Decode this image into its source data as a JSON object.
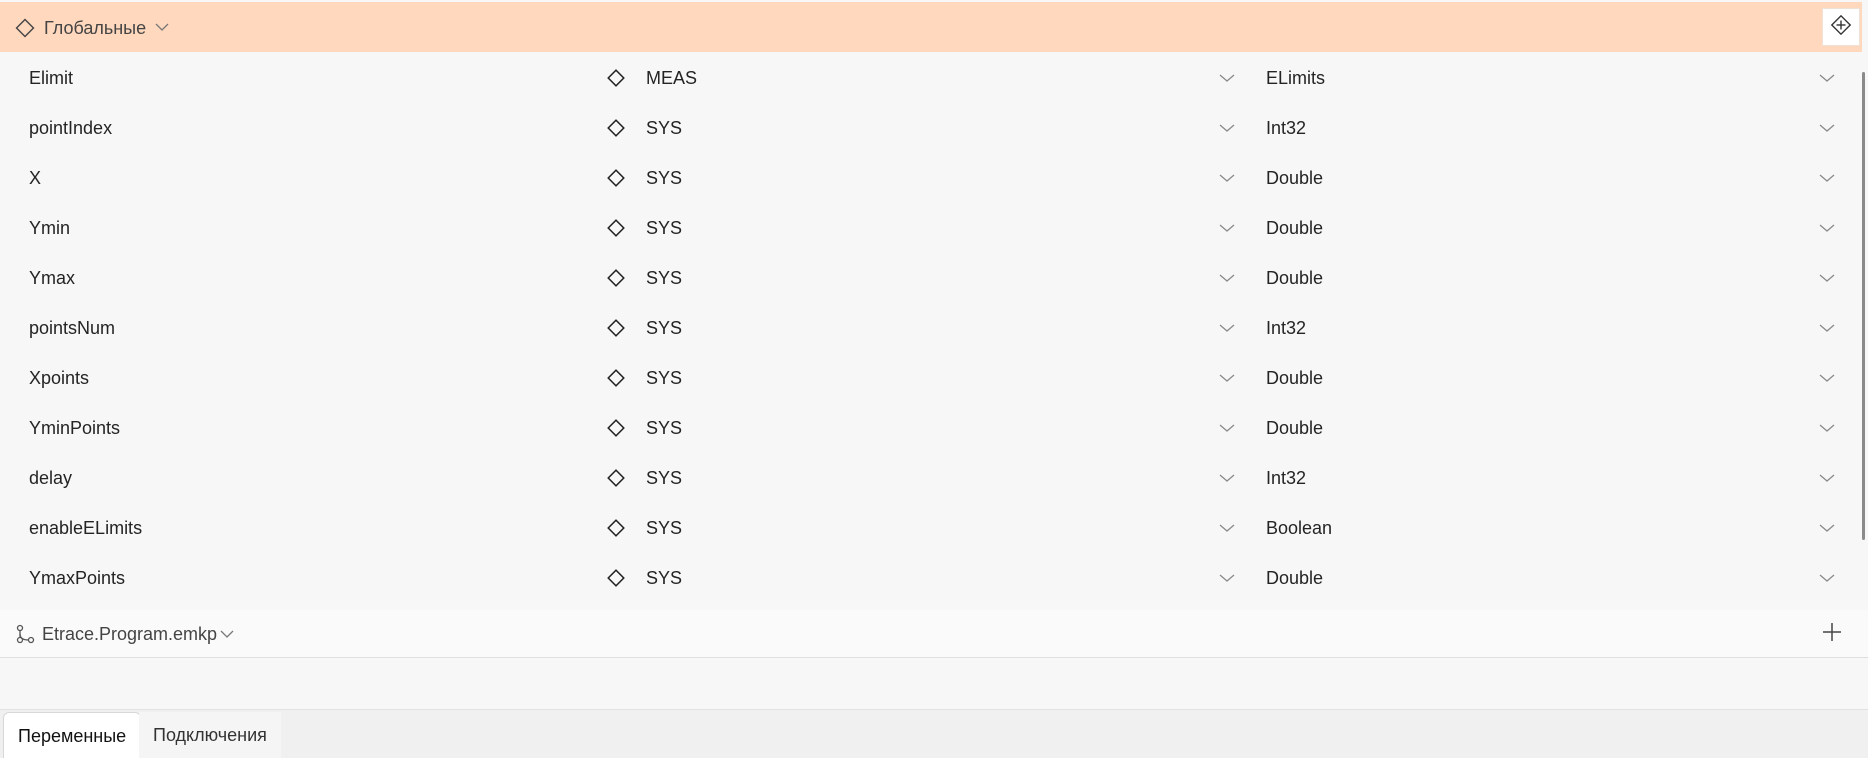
{
  "globals_header": {
    "label": "Глобальные",
    "icon": "diamond-icon",
    "chevron": "chevron-down-icon",
    "add_button_icon": "diamond-plus-icon",
    "background": "#ffd8bd"
  },
  "variables": [
    {
      "name": "Elimit",
      "scope": "MEAS",
      "type": "ELimits"
    },
    {
      "name": "pointIndex",
      "scope": "SYS",
      "type": "Int32"
    },
    {
      "name": "X",
      "scope": "SYS",
      "type": "Double"
    },
    {
      "name": "Ymin",
      "scope": "SYS",
      "type": "Double"
    },
    {
      "name": "Ymax",
      "scope": "SYS",
      "type": "Double"
    },
    {
      "name": "pointsNum",
      "scope": "SYS",
      "type": "Int32"
    },
    {
      "name": "Xpoints",
      "scope": "SYS",
      "type": "Double"
    },
    {
      "name": "YminPoints",
      "scope": "SYS",
      "type": "Double"
    },
    {
      "name": "delay",
      "scope": "SYS",
      "type": "Int32"
    },
    {
      "name": "enableELimits",
      "scope": "SYS",
      "type": "Boolean"
    },
    {
      "name": "YmaxPoints",
      "scope": "SYS",
      "type": "Double"
    }
  ],
  "program_header": {
    "label": "Etrace.Program.emkp",
    "icon": "branch-icon",
    "chevron": "chevron-down-icon",
    "add_icon": "plus-icon"
  },
  "tabs": [
    {
      "label": "Переменные",
      "active": true
    },
    {
      "label": "Подключения",
      "active": false
    }
  ]
}
